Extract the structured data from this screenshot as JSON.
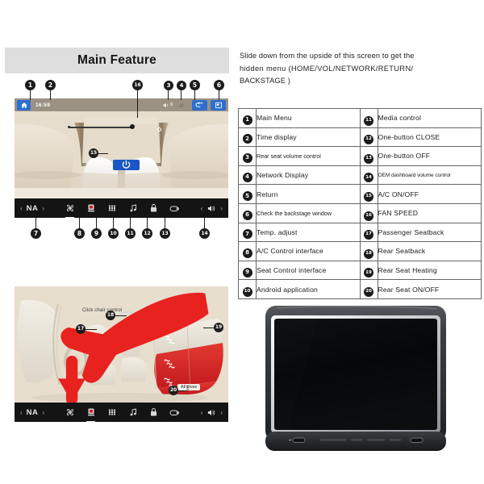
{
  "header": {
    "title": "Main Feature"
  },
  "intro": {
    "line1": "Slide down from the upside of this screen to get the",
    "line2": "hidden  menu  (HOME/VOL/NETWORK/RETURN/",
    "line3": "BACKSTAGE )"
  },
  "feature_table": {
    "rows": [
      {
        "left_num": "1",
        "left_label": "Main Menu",
        "right_num": "11",
        "right_label": "Media control"
      },
      {
        "left_num": "2",
        "left_label": "Time display",
        "right_num": "12",
        "right_label": "One-button CLOSE"
      },
      {
        "left_num": "3",
        "left_label": "Rear seat volume control",
        "right_num": "13",
        "right_label": "One-button OFF"
      },
      {
        "left_num": "4",
        "left_label": "Network Display",
        "right_num": "14",
        "right_label": "OEM dashboard volume control"
      },
      {
        "left_num": "5",
        "left_label": "Return",
        "right_num": "15",
        "right_label": "A/C ON/OFF"
      },
      {
        "left_num": "6",
        "left_label": "Check the backstage window",
        "right_num": "16",
        "right_label": "FAN SPEED"
      },
      {
        "left_num": "7",
        "left_label": "Temp. adjust",
        "right_num": "17",
        "right_label": "Passenger Seatback"
      },
      {
        "left_num": "8",
        "left_label": "A/C Control  interface",
        "right_num": "18",
        "right_label": "Rear Seatback"
      },
      {
        "left_num": "9",
        "left_label": "Seat Control  interface",
        "right_num": "19",
        "right_label": "Rear Seat Heating"
      },
      {
        "left_num": "10",
        "left_label": "Android application",
        "right_num": "20",
        "right_label": "Rear Seat ON/OFF"
      }
    ]
  },
  "screenshot1": {
    "statusbar": {
      "home_icon": "home-icon",
      "time": "16:59",
      "volume_icon": "speaker-icon",
      "volume_value": "8",
      "network_icon": "signal-triangle-icon",
      "return_icon": "return-arrow-icon",
      "backstage_icon": "backstage-window-icon"
    },
    "ac_power_button_icon": "power-icon",
    "fan_speed_slider": "fan-speed-slider",
    "toolbar": {
      "temp_prev": "‹",
      "temp_value": "NA",
      "temp_next": "›",
      "icons": [
        {
          "name": "ac-control-icon",
          "active": false
        },
        {
          "name": "seat-control-icon",
          "active": false
        },
        {
          "name": "android-apps-icon",
          "active": false
        },
        {
          "name": "media-control-icon",
          "active": false
        },
        {
          "name": "one-button-close-icon",
          "active": false
        },
        {
          "name": "one-button-off-icon",
          "active": false
        }
      ],
      "vol_prev": "‹",
      "vol_icon": "speaker-icon",
      "vol_next": "›"
    },
    "callouts": [
      "1",
      "2",
      "16",
      "3",
      "4",
      "5",
      "6",
      "7",
      "8",
      "9",
      "10",
      "11",
      "12",
      "13",
      "14",
      "15"
    ]
  },
  "screenshot2": {
    "click_hint": "Click chair control",
    "all_close_label": "All close",
    "all_close_icon": "heat-wave-icon",
    "cursor_icon": "red-hand-cursor-icon",
    "toolbar": {
      "temp_prev": "‹",
      "temp_value": "NA",
      "temp_next": "›",
      "active_icon": "seat-control-icon",
      "vol_prev": "‹",
      "vol_icon": "speaker-icon",
      "vol_next": "›"
    },
    "callouts": [
      "17",
      "18",
      "19",
      "20"
    ]
  },
  "product": {
    "name": "headrest-monitor",
    "screen_state": "off"
  },
  "colors": {
    "band_bg": "#dedede",
    "accent_blue": "#2d6fd0",
    "power_blue": "#1a56c4",
    "toolbar_bg": "#141414",
    "statusbar_bg": "#9c9284",
    "cabin_beige": "#e5dccb",
    "heat_red": "#d8232a",
    "cursor_red": "#e8221f"
  }
}
